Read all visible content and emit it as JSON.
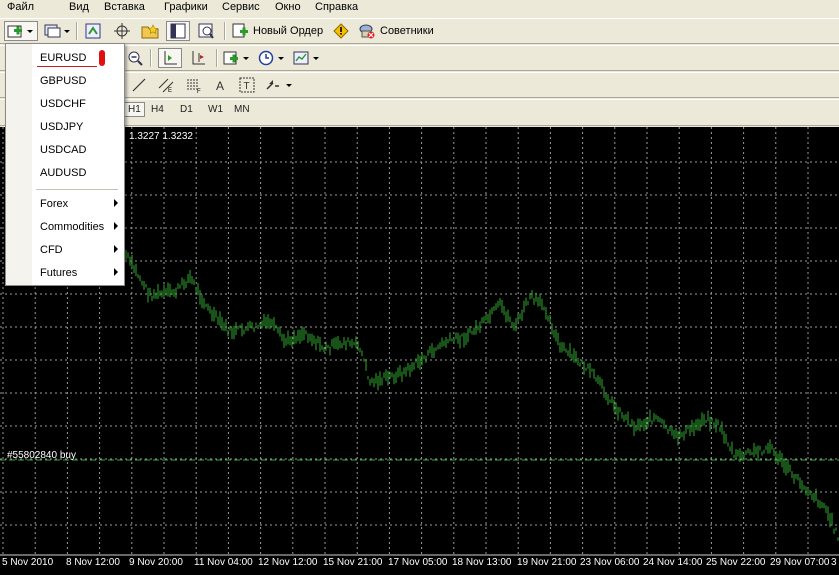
{
  "menu": [
    "Файл",
    "Вид",
    "Вставка",
    "Графики",
    "Сервис",
    "Окно",
    "Справка"
  ],
  "toolbar": {
    "new_order_label": "Новый Ордер",
    "experts_label": "Советники"
  },
  "timeframes": [
    "H1",
    "H4",
    "D1",
    "W1",
    "MN"
  ],
  "symbol_dropdown": {
    "symbols": [
      "EURUSD",
      "GBPUSD",
      "USDCHF",
      "USDJPY",
      "USDCAD",
      "AUDUSD"
    ],
    "groups": [
      "Forex",
      "Commodities",
      "CFD",
      "Futures"
    ]
  },
  "chart": {
    "price_header": "1.3227 1.3232",
    "order_label": "#55802840 buy",
    "time_labels": [
      "5 Nov 2010",
      "8 Nov 12:00",
      "9 Nov 20:00",
      "11 Nov 04:00",
      "12 Nov 12:00",
      "15 Nov 21:00",
      "17 Nov 05:00",
      "18 Nov 13:00",
      "19 Nov 21:00",
      "23 Nov 06:00",
      "24 Nov 14:00",
      "25 Nov 22:00",
      "29 Nov 07:00",
      "3"
    ],
    "colors": {
      "background": "#000000",
      "grid": "#9a9a9a",
      "bars": "#2fa82f",
      "order_line": "#2fa82f"
    }
  }
}
